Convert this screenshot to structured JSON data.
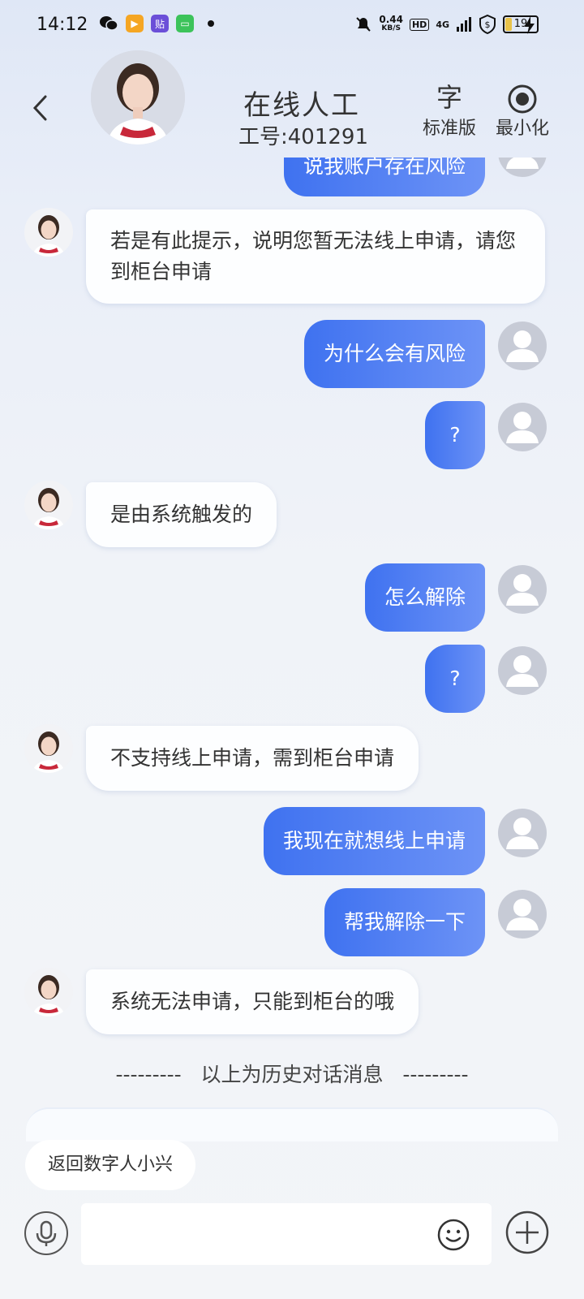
{
  "status_bar": {
    "time": "14:12",
    "speed_value": "0.44",
    "speed_unit": "KB/S",
    "hd": "HD",
    "network": "4G",
    "battery": "19"
  },
  "header": {
    "title": "在线人工",
    "subtitle": "工号:401291",
    "font_icon": "字",
    "font_label": "标准版",
    "minimize_label": "最小化"
  },
  "messages": [
    {
      "from": "user",
      "text": "说我账户存在风险"
    },
    {
      "from": "agent",
      "text": "若是有此提示，说明您暂无法线上申请，请您到柜台申请"
    },
    {
      "from": "user",
      "text": "为什么会有风险"
    },
    {
      "from": "user",
      "text": "?"
    },
    {
      "from": "agent",
      "text": "是由系统触发的"
    },
    {
      "from": "user",
      "text": "怎么解除"
    },
    {
      "from": "user",
      "text": "?"
    },
    {
      "from": "agent",
      "text": "不支持线上申请，需到柜台申请"
    },
    {
      "from": "user",
      "text": "我现在就想线上申请"
    },
    {
      "from": "user",
      "text": "帮我解除一下"
    },
    {
      "from": "agent",
      "text": "系统无法申请，只能到柜台的哦"
    }
  ],
  "history_separator": "---------   以上为历史对话消息   ---------",
  "return_chip": "返回数字人小兴",
  "input": {
    "value": "",
    "placeholder": ""
  },
  "colors": {
    "user_bubble": "#4a7af2",
    "agent_bubble": "#fdfeff"
  }
}
